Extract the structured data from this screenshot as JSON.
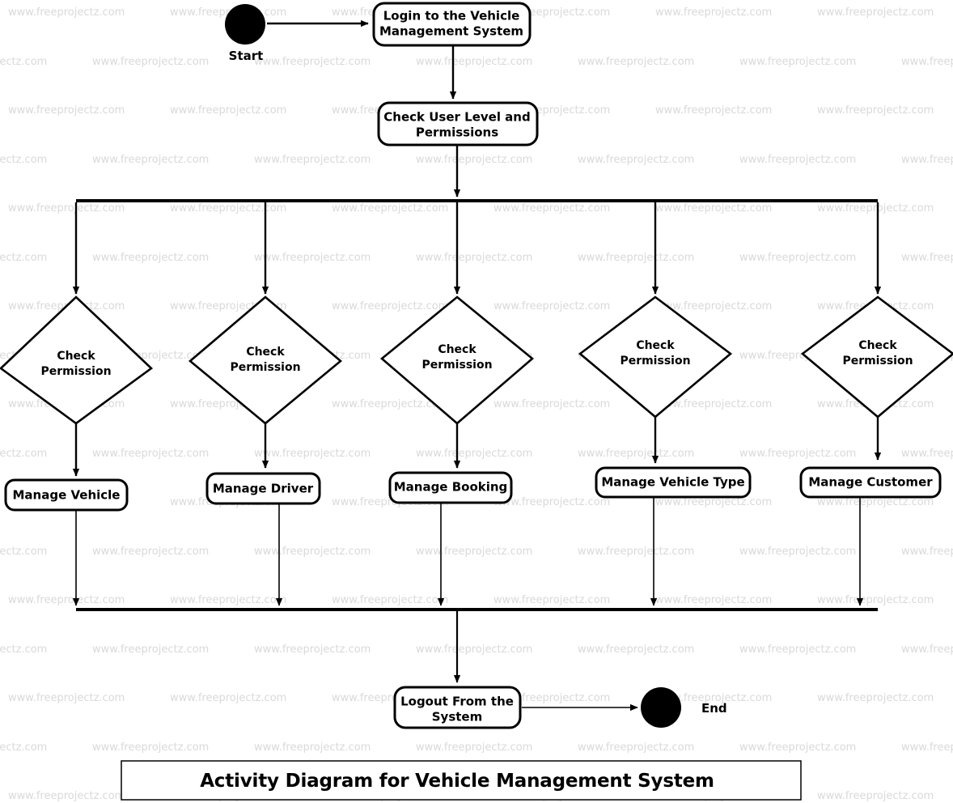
{
  "diagram": {
    "kind": "uml-activity-diagram",
    "title": "Activity Diagram for Vehicle Management System",
    "watermark_text": "www.freeprojectz.com",
    "colors": {
      "background": "#ffffff",
      "stroke": "#000000",
      "node_fill": "#ffffff",
      "watermark": "#d9d9d9"
    },
    "nodes": {
      "start": {
        "label": "Start",
        "type": "initial-node"
      },
      "end": {
        "label": "End",
        "type": "final-node"
      },
      "login": {
        "label": "Login to the Vehicle Management System",
        "line1": "Login to the Vehicle",
        "line2": "Management System",
        "type": "action"
      },
      "check_user": {
        "label": "Check User Level and Permissions",
        "line1": "Check User Level and",
        "line2": "Permissions",
        "type": "action"
      },
      "logout": {
        "label": "Logout From the System",
        "line1": "Logout From the",
        "line2": "System",
        "type": "action"
      }
    },
    "fork": {
      "label": "fork-bar",
      "type": "fork-node"
    },
    "join": {
      "label": "join-bar",
      "type": "join-node"
    },
    "branches": [
      {
        "decision": {
          "line1": "Check",
          "line2": "Permission",
          "label": "Check Permission",
          "type": "decision"
        },
        "action": {
          "label": "Manage Vehicle",
          "type": "action"
        }
      },
      {
        "decision": {
          "line1": "Check",
          "line2": "Permission",
          "label": "Check Permission",
          "type": "decision"
        },
        "action": {
          "label": "Manage Driver",
          "type": "action"
        }
      },
      {
        "decision": {
          "line1": "Check",
          "line2": "Permission",
          "label": "Check Permission",
          "type": "decision"
        },
        "action": {
          "label": "Manage Booking",
          "type": "action"
        }
      },
      {
        "decision": {
          "line1": "Check",
          "line2": "Permission",
          "label": "Check Permission",
          "type": "decision"
        },
        "action": {
          "label": "Manage Vehicle Type",
          "type": "action"
        }
      },
      {
        "decision": {
          "line1": "Check",
          "line2": "Permission",
          "label": "Check Permission",
          "type": "decision"
        },
        "action": {
          "label": "Manage Customer",
          "type": "action"
        }
      }
    ]
  }
}
